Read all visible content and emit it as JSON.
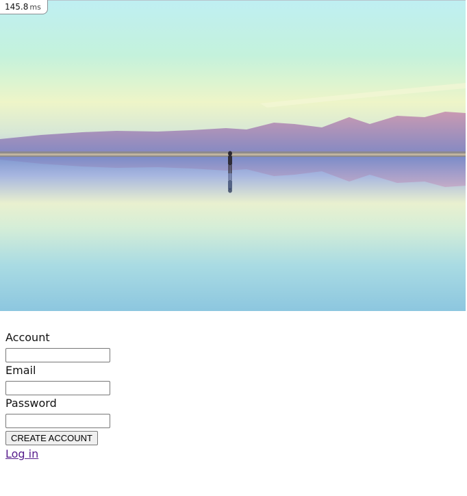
{
  "perf_overlay": {
    "value": "145.8",
    "unit": "ms"
  },
  "hero": {
    "image_description_icon": "landscape-photo"
  },
  "form": {
    "account_label": "Account",
    "account_value": "",
    "email_label": "Email",
    "email_value": "",
    "password_label": "Password",
    "password_value": "",
    "submit_label": "CREATE ACCOUNT",
    "login_link_label": "Log in"
  },
  "colors": {
    "link_visited": "#551a8b",
    "button_bg": "#efefef",
    "input_border": "#767676"
  }
}
